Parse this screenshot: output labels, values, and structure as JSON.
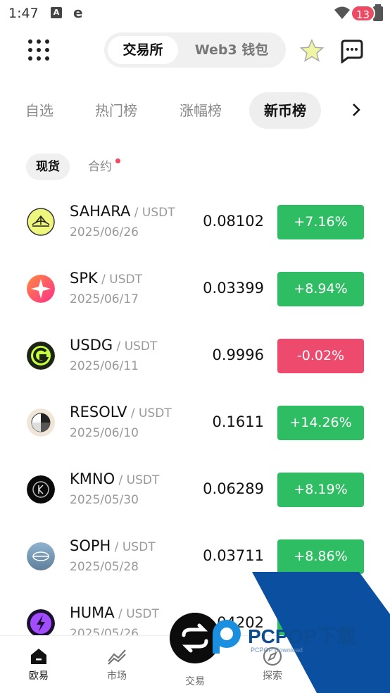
{
  "status_bar": {
    "time": "1:47",
    "notif_a": "A",
    "notif_e": "e"
  },
  "header": {
    "seg_active": "交易所",
    "seg_inactive": "Web3 钱包",
    "message_count": "13"
  },
  "tabs": [
    "自选",
    "热门榜",
    "涨幅榜",
    "新币榜"
  ],
  "active_tab_index": 3,
  "subtabs": {
    "spot": "现货",
    "futures": "合约"
  },
  "rows": [
    {
      "symbol": "SAHARA",
      "quote": " / USDT",
      "date": "2025/06/26",
      "price": "0.08102",
      "change": "+7.16%",
      "direction": "up"
    },
    {
      "symbol": "SPK",
      "quote": " / USDT",
      "date": "2025/06/17",
      "price": "0.03399",
      "change": "+8.94%",
      "direction": "up"
    },
    {
      "symbol": "USDG",
      "quote": " / USDT",
      "date": "2025/06/11",
      "price": "0.9996",
      "change": "-0.02%",
      "direction": "down"
    },
    {
      "symbol": "RESOLV",
      "quote": " / USDT",
      "date": "2025/06/10",
      "price": "0.1611",
      "change": "+14.26%",
      "direction": "up"
    },
    {
      "symbol": "KMNO",
      "quote": " / USDT",
      "date": "2025/05/30",
      "price": "0.06289",
      "change": "+8.19%",
      "direction": "up"
    },
    {
      "symbol": "SOPH",
      "quote": " / USDT",
      "date": "2025/05/28",
      "price": "0.03711",
      "change": "+8.86%",
      "direction": "up"
    },
    {
      "symbol": "HUMA",
      "quote": " / USDT",
      "date": "2025/05/26",
      "price": "0.04202",
      "change": "",
      "direction": "up"
    }
  ],
  "bottom_nav": {
    "home": "欧易",
    "market": "市场",
    "trade": "交易",
    "explore": "探索"
  },
  "watermark": {
    "brand": "PCPOP下载",
    "sub": "PCPOP Download"
  },
  "colors": {
    "up": "#2ebd63",
    "down": "#ee4a6d",
    "badge": "#ef4a63"
  }
}
